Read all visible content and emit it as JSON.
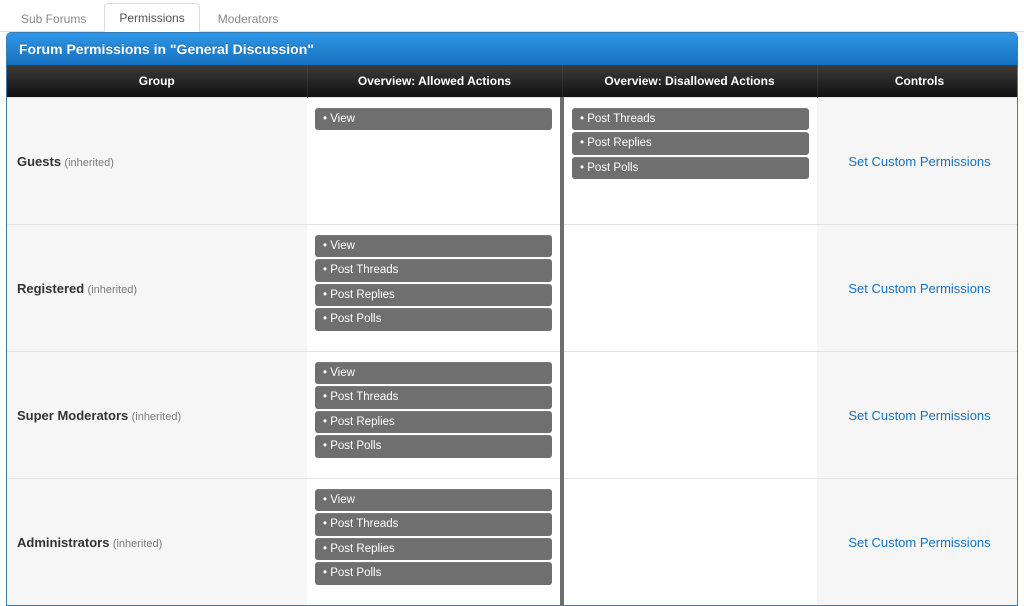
{
  "tabs": {
    "items": [
      {
        "label": "Sub Forums",
        "active": false
      },
      {
        "label": "Permissions",
        "active": true
      },
      {
        "label": "Moderators",
        "active": false
      }
    ]
  },
  "panel": {
    "title": "Forum Permissions in \"General Discussion\""
  },
  "table": {
    "headers": {
      "group": "Group",
      "allow": "Overview: Allowed Actions",
      "disallow": "Overview: Disallowed Actions",
      "controls": "Controls"
    },
    "bullet": "• ",
    "control_label": "Set Custom Permissions",
    "rows": [
      {
        "group": "Guests",
        "note": "(inherited)",
        "allowed": [
          "View"
        ],
        "disallowed": [
          "Post Threads",
          "Post Replies",
          "Post Polls"
        ]
      },
      {
        "group": "Registered",
        "note": "(inherited)",
        "allowed": [
          "View",
          "Post Threads",
          "Post Replies",
          "Post Polls"
        ],
        "disallowed": []
      },
      {
        "group": "Super Moderators",
        "note": "(inherited)",
        "allowed": [
          "View",
          "Post Threads",
          "Post Replies",
          "Post Polls"
        ],
        "disallowed": []
      },
      {
        "group": "Administrators",
        "note": "(inherited)",
        "allowed": [
          "View",
          "Post Threads",
          "Post Replies",
          "Post Polls"
        ],
        "disallowed": []
      }
    ]
  }
}
